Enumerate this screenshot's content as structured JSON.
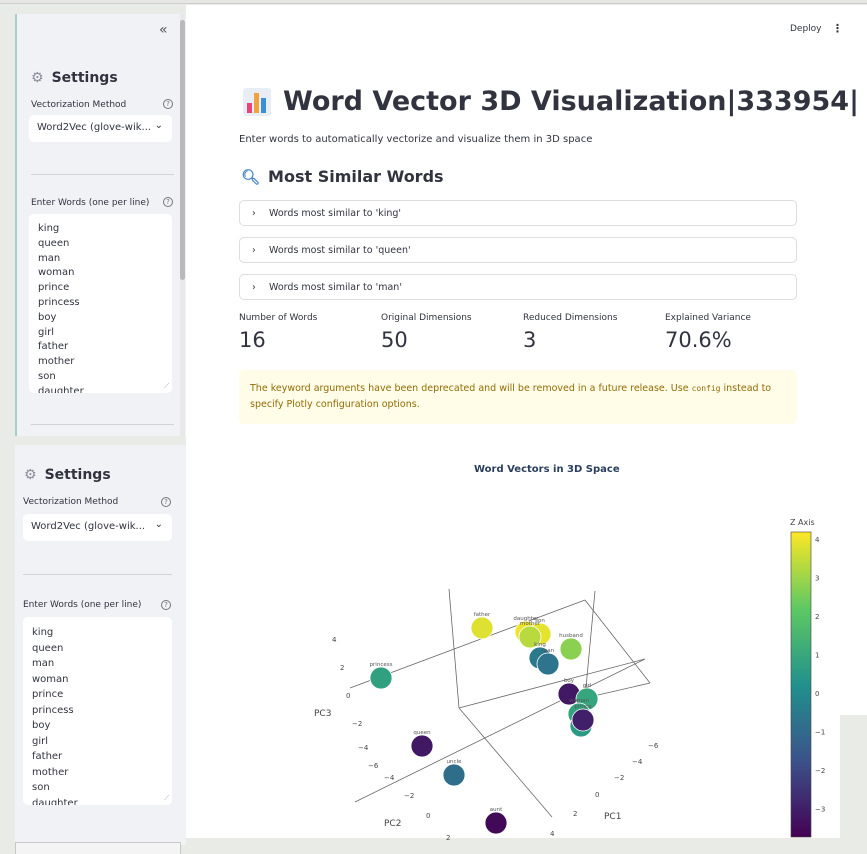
{
  "sidebar": {
    "collapse_icon": "chevron-double-left-icon",
    "settings_title": "Settings",
    "method_label": "Vectorization Method",
    "method_value": "Word2Vec (glove-wik...",
    "words_label": "Enter Words (one per line)",
    "words": [
      "king",
      "queen",
      "man",
      "woman",
      "prince",
      "princess",
      "boy",
      "girl",
      "father",
      "mother",
      "son",
      "daughter"
    ]
  },
  "header": {
    "deploy": "Deploy",
    "menu_icon": "kebab-menu-icon"
  },
  "main": {
    "title": "Word Vector 3D Visualization|333954|",
    "subtitle": "Enter words to automatically vectorize and visualize them in 3D space",
    "similar_heading": "Most Similar Words",
    "expanders": [
      "Words most similar to 'king'",
      "Words most similar to 'queen'",
      "Words most similar to 'man'"
    ],
    "metrics": [
      {
        "label": "Number of Words",
        "value": "16"
      },
      {
        "label": "Original Dimensions",
        "value": "50"
      },
      {
        "label": "Reduced Dimensions",
        "value": "3"
      },
      {
        "label": "Explained Variance",
        "value": "70.6%"
      }
    ],
    "warning_pre": "The keyword arguments have been deprecated and will be removed in a future release. Use ",
    "warning_code": "config",
    "warning_post": " instead to specify Plotly configuration options."
  },
  "chart_data": {
    "type": "scatter",
    "title": "Word Vectors in 3D Space",
    "axis_labels": {
      "x": "PC1",
      "y": "PC2",
      "z": "PC3"
    },
    "colorbar_title": "Z Axis",
    "colorbar_ticks": [
      "4",
      "3",
      "2",
      "1",
      "0",
      "−1",
      "−2",
      "−3"
    ],
    "pc3_ticks": [
      "4",
      "2",
      "0",
      "−2",
      "−4",
      "−6"
    ],
    "pc2_ticks": [
      "−4",
      "−2",
      "0",
      "2"
    ],
    "pc1_ticks": [
      "−6",
      "−4",
      "−2",
      "0",
      "2",
      "4"
    ],
    "points": [
      {
        "label": "father",
        "z": 3.9
      },
      {
        "label": "daughter",
        "z": 4.1
      },
      {
        "label": "son",
        "z": 4.0
      },
      {
        "label": "mother",
        "z": 3.4
      },
      {
        "label": "husband",
        "z": 2.8
      },
      {
        "label": "king",
        "z": -0.6
      },
      {
        "label": "man",
        "z": -0.8
      },
      {
        "label": "princess",
        "z": 0.7
      },
      {
        "label": "boy",
        "z": -3.4
      },
      {
        "label": "girl",
        "z": 0.9
      },
      {
        "label": "woman",
        "z": 0.8
      },
      {
        "label": "wife",
        "z": 0.5
      },
      {
        "label": "prince",
        "z": -3.2
      },
      {
        "label": "queen",
        "z": -3.4
      },
      {
        "label": "uncle",
        "z": -1.0
      },
      {
        "label": "aunt",
        "z": -3.8
      }
    ],
    "zlim": [
      -4,
      4.3
    ],
    "colorscale": [
      "#440154",
      "#3b528b",
      "#21918c",
      "#5ec962",
      "#fde725"
    ]
  }
}
